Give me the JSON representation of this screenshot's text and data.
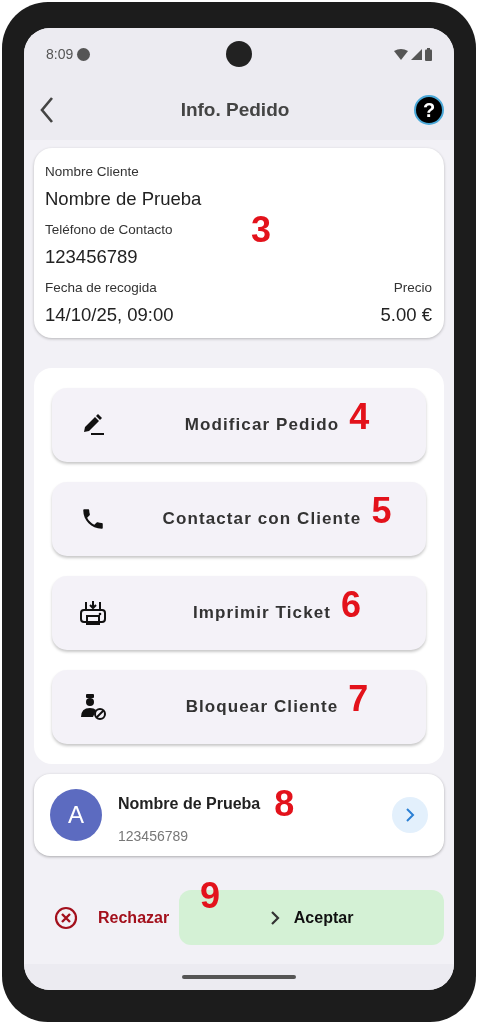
{
  "status_bar": {
    "time": "8:09"
  },
  "top_bar": {
    "title": "Info. Pedido",
    "help": "?"
  },
  "order": {
    "fields": [
      {
        "label": "Nombre Cliente",
        "value": "Nombre de Prueba"
      },
      {
        "label": "Teléfono de Contacto",
        "value": "123456789"
      }
    ],
    "pickup": {
      "label": "Fecha de recogida",
      "value": "14/10/25, 09:00"
    },
    "price": {
      "label": "Precio",
      "value": "5.00 €"
    },
    "annotation": "3"
  },
  "actions": [
    {
      "kind": "edit",
      "label": "Modificar Pedido",
      "annotation": "4"
    },
    {
      "kind": "phone",
      "label": "Contactar con Cliente",
      "annotation": "5"
    },
    {
      "kind": "print",
      "label": "Imprimir Ticket",
      "annotation": "6"
    },
    {
      "kind": "block-user",
      "label": "Bloquear Cliente",
      "annotation": "7"
    }
  ],
  "client": {
    "initial": "A",
    "name": "Nombre de Prueba",
    "phone": "123456789",
    "annotation": "8"
  },
  "footer": {
    "reject": "Rechazar",
    "accept": "Aceptar",
    "annotation": "9"
  }
}
